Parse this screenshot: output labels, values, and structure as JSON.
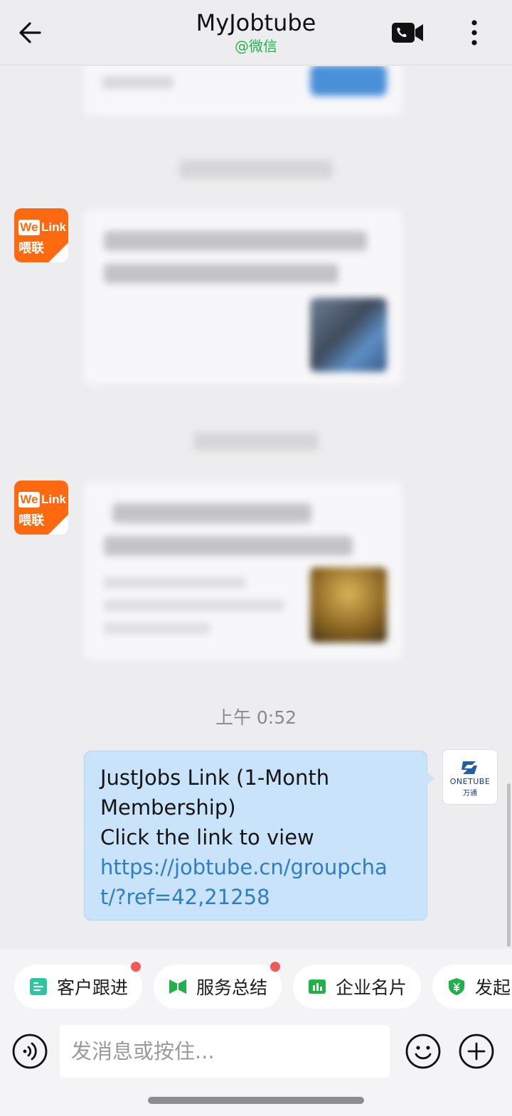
{
  "header": {
    "title": "MyJobtube",
    "subtitle": "@微信",
    "back_icon": "back-arrow-icon",
    "video_icon": "video-call-icon",
    "more_icon": "more-vertical-icon"
  },
  "chat": {
    "timestamp": "上午 0:52",
    "message": {
      "line1": "JustJobs Link (1-Month Membership)",
      "line2": "Click the link to view",
      "url": "https://jobtube.cn/groupchat/?ref=42,21258"
    },
    "welink_avatar": {
      "we": "We",
      "link": "Link",
      "cn": "喂联"
    },
    "onetube_avatar": {
      "name": "ONETUBE",
      "cn": "万通"
    }
  },
  "quick_actions": [
    {
      "label": "客户跟进",
      "icon": "customer-followup-icon",
      "color": "#2ec4a0",
      "badge": true
    },
    {
      "label": "服务总结",
      "icon": "service-summary-icon",
      "color": "#22b04a",
      "badge": true
    },
    {
      "label": "企业名片",
      "icon": "business-card-icon",
      "color": "#22b04a",
      "badge": false
    },
    {
      "label": "发起",
      "icon": "payment-shield-icon",
      "color": "#22b04a",
      "badge": false
    }
  ],
  "input": {
    "placeholder": "发消息或按住...",
    "voice_icon": "voice-icon",
    "emoji_icon": "emoji-icon",
    "plus_icon": "plus-icon"
  },
  "colors": {
    "accent_green": "#21b34c",
    "bubble_blue": "#c9e3fb",
    "link_blue": "#2e7ec4",
    "welink_orange": "#ff6a10"
  }
}
